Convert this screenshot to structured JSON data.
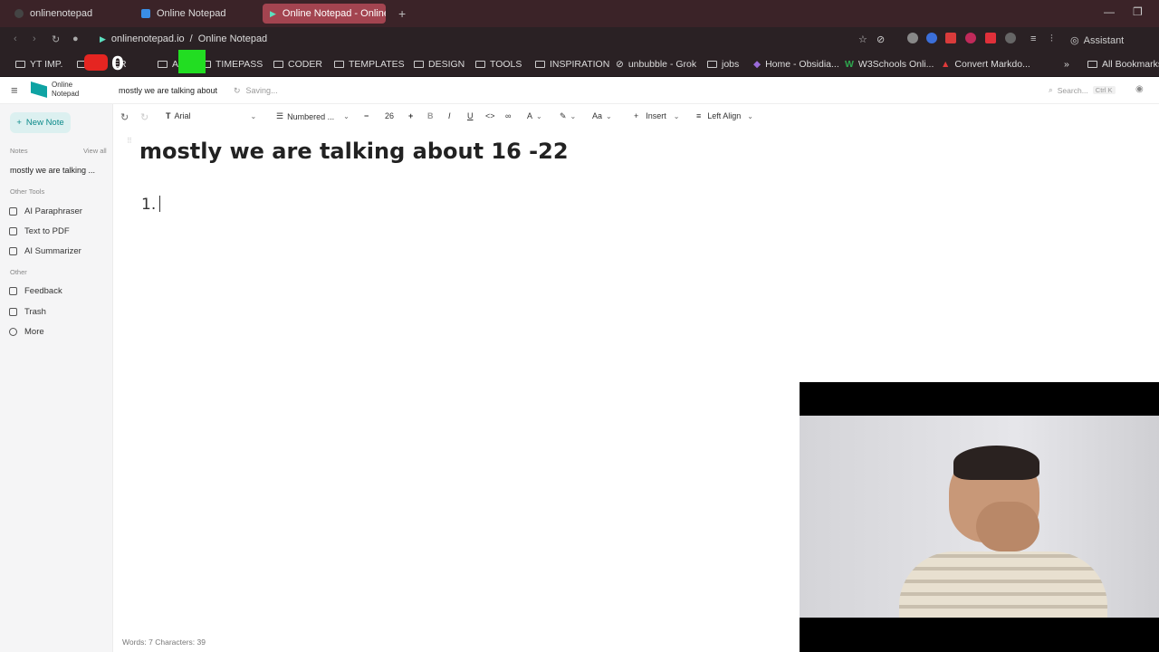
{
  "browser": {
    "tabs": [
      {
        "label": "onlinenotepad",
        "active": false
      },
      {
        "label": "Online Notepad",
        "active": false
      },
      {
        "label": "Online Notepad - Online T",
        "active": true
      }
    ],
    "new_tab": "+",
    "url": "onlinenotepad.io",
    "url_sep": "/",
    "page_title": "Online Notepad",
    "assistant_label": "Assistant",
    "bookmarks": [
      "YT IMP.",
      "ER",
      "A",
      "TIMEPASS",
      "CODER",
      "TEMPLATES",
      "DESIGN",
      "TOOLS",
      "INSPIRATION",
      "unbubble - Grok",
      "jobs",
      "Home - Obsidia...",
      "W3Schools Onli...",
      "Convert Markdo..."
    ],
    "bookmarks_more": "»",
    "all_bookmarks": "All Bookmarks"
  },
  "app": {
    "logo_line1": "Online",
    "logo_line2": "Notepad",
    "note_title": "mostly we are talking about",
    "save_status": "Saving...",
    "search_placeholder": "Search...",
    "search_shortcut": "Ctrl K"
  },
  "sidebar": {
    "new_note": "New Note",
    "notes_header": "Notes",
    "view_all": "View all",
    "current_note": "mostly we are talking ...",
    "other_tools_header": "Other Tools",
    "tools": [
      {
        "label": "AI Paraphraser",
        "icon": "doc-icon"
      },
      {
        "label": "Text to PDF",
        "icon": "pdf-icon"
      },
      {
        "label": "AI Summarizer",
        "icon": "summarize-icon"
      }
    ],
    "other_header": "Other",
    "other": [
      {
        "label": "Feedback",
        "icon": "feedback-icon"
      },
      {
        "label": "Trash",
        "icon": "trash-icon"
      },
      {
        "label": "More",
        "icon": "more-icon"
      }
    ]
  },
  "toolbar": {
    "font": "Arial",
    "list_style": "Numbered ...",
    "font_size": "26",
    "insert": "Insert",
    "align": "Left Align",
    "bold": "B",
    "italic": "I",
    "underline": "U",
    "case": "Aa"
  },
  "editor": {
    "heading": "mostly we are talking about 16 -22",
    "list_marker": "1."
  },
  "status": {
    "words": "Words: 7",
    "characters": "Characters: 39"
  },
  "colors": {
    "tabbar_bg": "#3b2328",
    "active_tab": "#a34450",
    "chrome_bg": "#2a2124",
    "accent": "#0fa3a3",
    "sidebar_bg": "#f5f5f6"
  }
}
